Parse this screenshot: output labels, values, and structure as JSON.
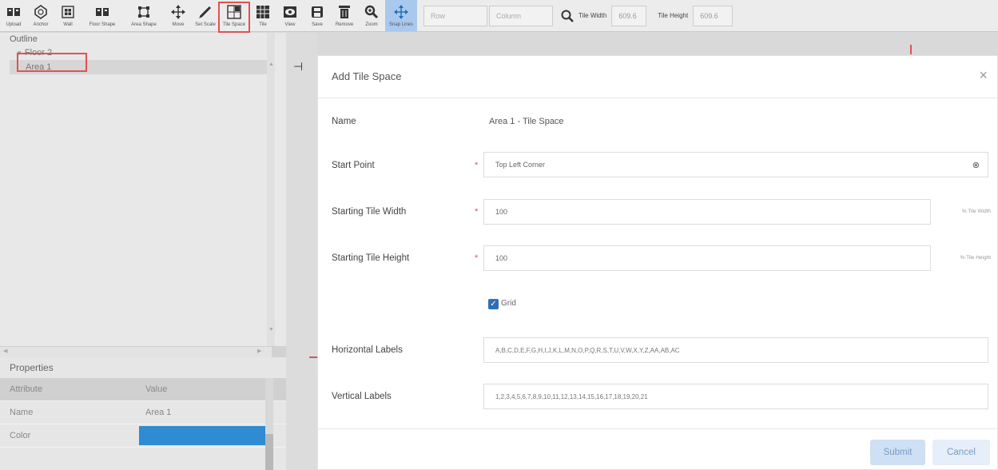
{
  "toolbar": {
    "tools": [
      {
        "label": "Upload",
        "icon": "upload-icon"
      },
      {
        "label": "Anchor",
        "icon": "anchor-icon"
      },
      {
        "label": "Wall",
        "icon": "wall-icon"
      },
      {
        "label": "Floor Shape",
        "icon": "floor-shape-icon"
      },
      {
        "label": "Area Shape",
        "icon": "area-shape-icon"
      },
      {
        "label": "Move",
        "icon": "move-icon"
      },
      {
        "label": "Set Scale",
        "icon": "pencil-icon"
      },
      {
        "label": "Tile Space",
        "icon": "tile-space-icon"
      },
      {
        "label": "Tile",
        "icon": "tile-icon"
      },
      {
        "label": "View",
        "icon": "view-icon"
      },
      {
        "label": "Save",
        "icon": "save-icon"
      },
      {
        "label": "Remove",
        "icon": "trash-icon"
      },
      {
        "label": "Zoom",
        "icon": "zoom-icon"
      },
      {
        "label": "Snap Lines",
        "icon": "snap-lines-icon"
      }
    ],
    "row_placeholder": "Row",
    "column_placeholder": "Column",
    "tile_width_label": "Tile Width",
    "tile_width_value": "609.6",
    "tile_height_label": "Tile Height",
    "tile_height_value": "609.6"
  },
  "outline": {
    "title": "Outline",
    "floor": "Floor 2",
    "area": "Area 1"
  },
  "properties": {
    "title": "Properties",
    "col_attribute": "Attribute",
    "col_value": "Value",
    "rows": [
      {
        "attr": "Name",
        "value": "Area 1"
      },
      {
        "attr": "Color",
        "value": ""
      }
    ],
    "color_swatch": "#2f8bd2"
  },
  "modal": {
    "title": "Add Tile Space",
    "name_label": "Name",
    "name_value": "Area 1 - Tile Space",
    "start_point_label": "Start Point",
    "start_point_value": "Top Left Corner",
    "tile_width_label": "Starting Tile Width",
    "tile_width_value": "100",
    "tile_width_unit": "% Tile Width",
    "tile_height_label": "Starting Tile Height",
    "tile_height_value": "100",
    "tile_height_unit": "% Tile Height",
    "grid_label": "Grid",
    "grid_checked": true,
    "h_labels_label": "Horizontal Labels",
    "h_labels_value": "A,B,C,D,E,F,G,H,I,J,K,L,M,N,O,P,Q,R,S,T,U,V,W,X,Y,Z,AA,AB,AC",
    "v_labels_label": "Vertical Labels",
    "v_labels_value": "1,2,3,4,5,6,7,8,9,10,11,12,13,14,15,16,17,18,19,20,21",
    "submit": "Submit",
    "cancel": "Cancel"
  }
}
